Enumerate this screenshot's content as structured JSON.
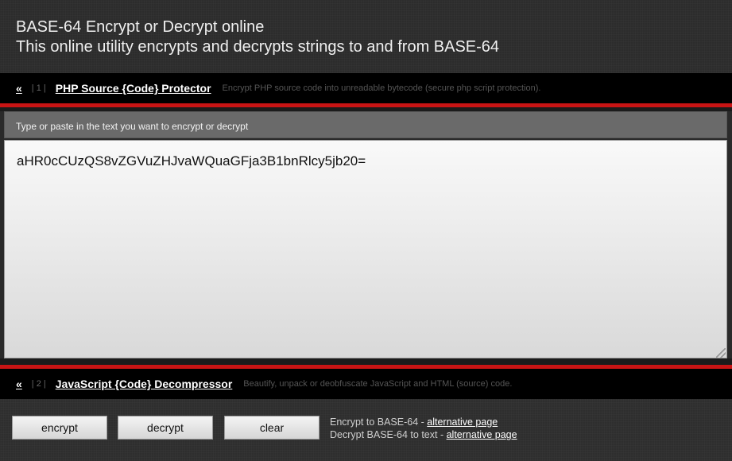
{
  "header": {
    "title": "BASE-64 Encrypt or Decrypt online",
    "subtitle": "This online utility encrypts and decrypts strings to and from BASE-64"
  },
  "nav_top": {
    "arrow": "«",
    "index": "| 1 |",
    "link": "PHP Source {Code} Protector",
    "description": "Encrypt PHP source code into unreadable bytecode (secure php script protection)."
  },
  "panel": {
    "label": "Type or paste in the text you want to encrypt or decrypt",
    "value": "aHR0cCUzQS8vZGVuZHJvaWQuaGFja3B1bnRlcy5jb20="
  },
  "nav_bottom": {
    "arrow": "«",
    "index": "| 2 |",
    "link": "JavaScript {Code} Decompressor",
    "description": "Beautify, unpack or deobfuscate JavaScript and HTML (source) code."
  },
  "buttons": {
    "encrypt": "encrypt",
    "decrypt": "decrypt",
    "clear": "clear"
  },
  "alternatives": {
    "encrypt_text": "Encrypt to BASE-64 - ",
    "encrypt_link": "alternative page",
    "decrypt_text": "Decrypt BASE-64 to text - ",
    "decrypt_link": "alternative page"
  },
  "colors": {
    "accent_red": "#c81414",
    "navbar": "#000000",
    "background": "#2a2a2a"
  }
}
